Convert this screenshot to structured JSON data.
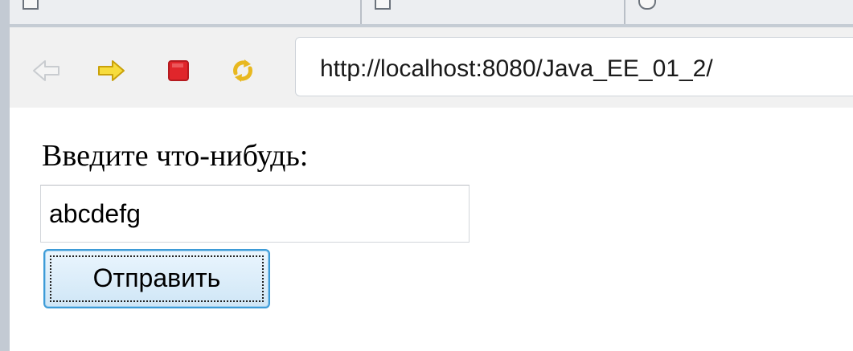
{
  "toolbar": {
    "buttons": [
      {
        "name": "back",
        "icon": "back-arrow-icon",
        "enabled": false
      },
      {
        "name": "forward",
        "icon": "forward-arrow-icon",
        "enabled": true
      },
      {
        "name": "stop",
        "icon": "stop-icon",
        "enabled": true
      },
      {
        "name": "reload",
        "icon": "reload-icon",
        "enabled": true
      }
    ],
    "address": "http://localhost:8080/Java_EE_01_2/"
  },
  "page": {
    "prompt": "Введите что-нибудь:",
    "input_value": "abcdefg",
    "submit_label": "Отправить"
  },
  "colors": {
    "forward_arrow": "#f5d020",
    "stop": "#e0262b",
    "reload": "#e8b820",
    "focus_border": "#3d9bd7"
  }
}
